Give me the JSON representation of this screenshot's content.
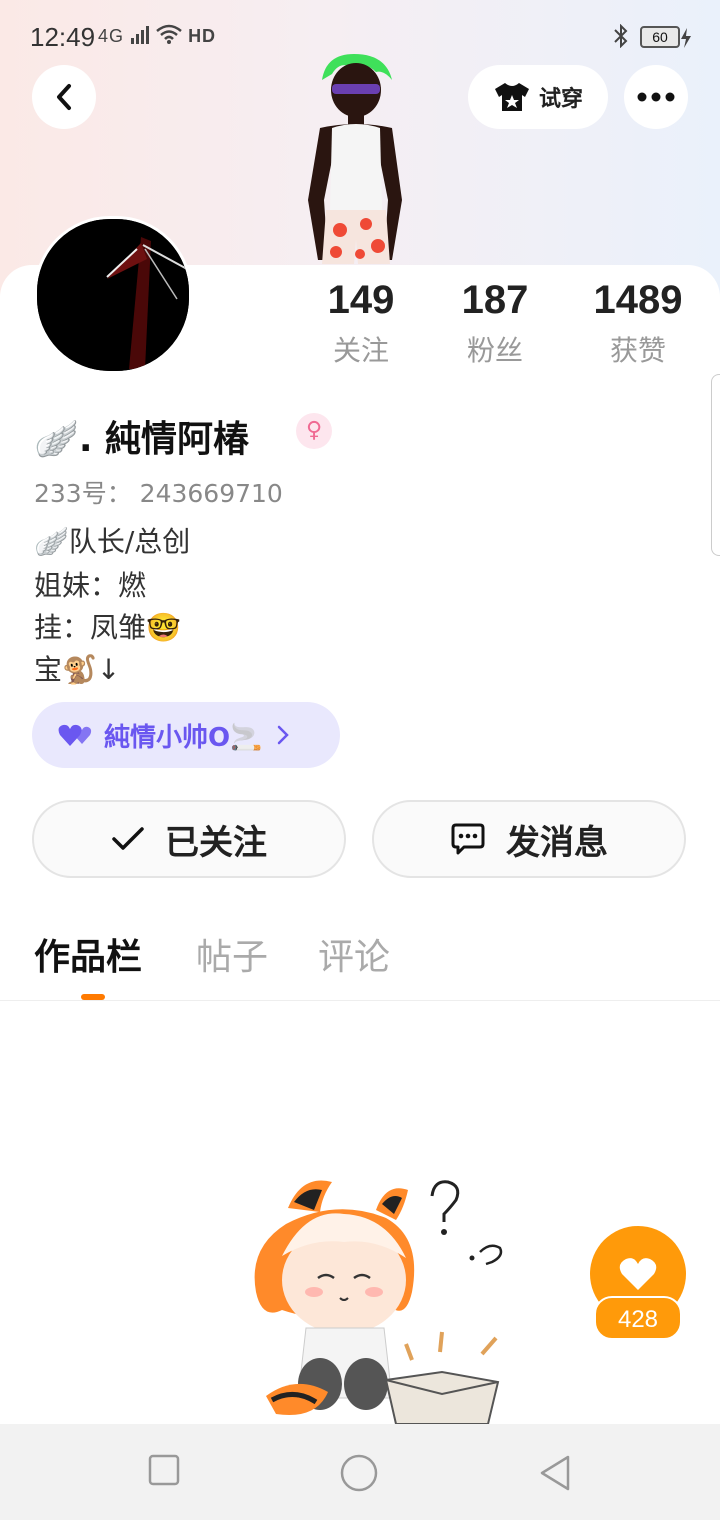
{
  "status_bar": {
    "time": "12:49",
    "network": "4G",
    "hd": "HD",
    "battery": "60"
  },
  "header": {
    "try_on_label": "试穿"
  },
  "stats": {
    "following": {
      "value": "149",
      "label": "关注"
    },
    "fans": {
      "value": "187",
      "label": "粉丝"
    },
    "likes": {
      "value": "1489",
      "label": "获赞"
    }
  },
  "profile": {
    "nickname": "🪽. 純情阿椿",
    "gender_symbol": "♀",
    "uid": "233号： 243669710",
    "bio": [
      "🪽队长/总创",
      "姐妹：燃",
      "挂：凤雏🤓",
      "宝🐒↓"
    ],
    "partner_pill": "純情小帅O🚬",
    "accent_color": "#6a57f0"
  },
  "actions": {
    "follow_label": "已关注",
    "message_label": "发消息"
  },
  "tabs": [
    {
      "label": "作品栏",
      "active": true
    },
    {
      "label": "帖子",
      "active": false
    },
    {
      "label": "评论",
      "active": false
    }
  ],
  "like_fab": {
    "count": "428",
    "color": "#ff9a0a"
  }
}
